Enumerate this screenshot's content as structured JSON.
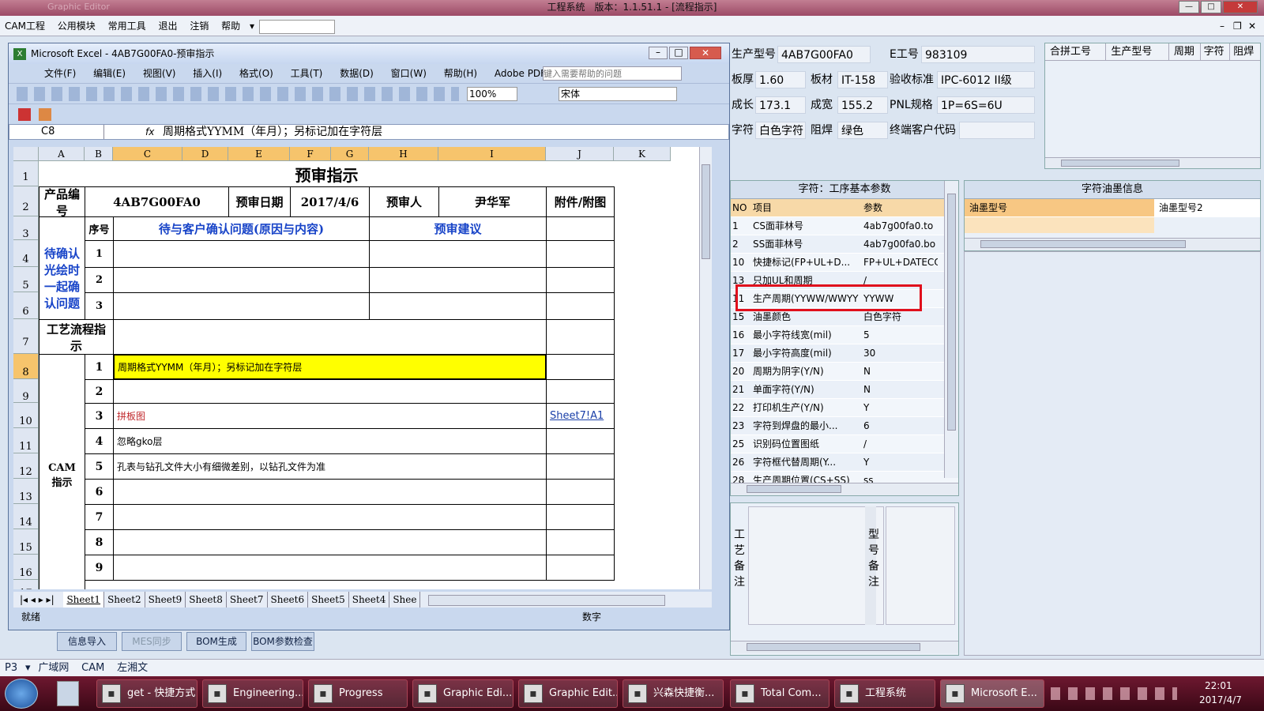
{
  "app": {
    "title": "工程系统　版本：1.1.51.1 - [流程指示]",
    "faint_title": "Graphic Editor",
    "min": "—",
    "max": "□",
    "close": "✕"
  },
  "menu": {
    "items": [
      "CAM工程",
      "公用模块",
      "常用工具",
      "退出",
      "注销",
      "帮助"
    ]
  },
  "info": {
    "model_label": "生产型号",
    "model": "4AB7G00FA0",
    "eno_label": "E工号",
    "eno": "983109",
    "thickness_label": "板厚",
    "thickness": "1.60",
    "material_label": "板材",
    "material": "IT-158",
    "standard_label": "验收标准",
    "standard": "IPC-6012 II级",
    "length_label": "成长",
    "length": "173.1",
    "width_label": "成宽",
    "width": "155.2",
    "pnl_label": "PNL规格",
    "pnl": "1P=6S=6U",
    "char_label": "字符",
    "char": "白色字符",
    "mask_label": "阻焊",
    "mask": "绿色",
    "enduser_label": "终端客户代码",
    "enduser": ""
  },
  "merge_table": {
    "headers": [
      "合拼工号",
      "生产型号",
      "周期",
      "字符",
      "阻焊"
    ]
  },
  "params": {
    "title": "字符：工序基本参数",
    "headers": [
      "NO",
      "项目",
      "参数"
    ],
    "rows": [
      [
        "1",
        "CS面菲林号",
        "4ab7g00fa0.to"
      ],
      [
        "2",
        "SS面菲林号",
        "4ab7g00fa0.bo"
      ],
      [
        "10",
        "快捷标记(FP+UL+D...",
        "FP+UL+DATECODE"
      ],
      [
        "13",
        "只加UL和周期",
        "/"
      ],
      [
        "11",
        "生产周期(YYWW/WWYY)",
        "YYWW"
      ],
      [
        "15",
        "油墨颜色",
        "白色字符"
      ],
      [
        "16",
        "最小字符线宽(mil)",
        "5"
      ],
      [
        "17",
        "最小字符高度(mil)",
        "30"
      ],
      [
        "20",
        "周期为阴字(Y/N)",
        "N"
      ],
      [
        "21",
        "单面字符(Y/N)",
        "N"
      ],
      [
        "22",
        "打印机生产(Y/N)",
        "Y"
      ],
      [
        "23",
        "字符到焊盘的最小...",
        "6"
      ],
      [
        "25",
        "识别码位置图纸",
        "/"
      ],
      [
        "26",
        "字符框代替周期(Y...",
        "Y"
      ],
      [
        "28",
        "生产周期位置(CS+SS)",
        "ss"
      ]
    ]
  },
  "ink": {
    "title": "字符油墨信息",
    "headers": [
      "油墨型号",
      "油墨型号2"
    ]
  },
  "remarks": {
    "process": "工艺备注",
    "model": "型号备注"
  },
  "bottom_buttons": [
    "信息导入",
    "MES同步",
    "BOM生成",
    "BOM参数检查"
  ],
  "statusrow": {
    "code": "P3",
    "items": [
      "广域网",
      "CAM",
      "左湘文"
    ]
  },
  "excel": {
    "title": "Microsoft Excel - 4AB7G00FA0-预审指示",
    "menu": [
      "文件(F)",
      "编辑(E)",
      "视图(V)",
      "插入(I)",
      "格式(O)",
      "工具(T)",
      "数据(D)",
      "窗口(W)",
      "帮助(H)",
      "Adobe PDF(B)"
    ],
    "help_placeholder": "键入需要帮助的问题",
    "zoom": "100%",
    "font": "宋体",
    "namebox": "C8",
    "fx": "fx",
    "formula": "周期格式YYMM（年月）；另标记加在字符层",
    "columns": [
      "A",
      "B",
      "C",
      "D",
      "E",
      "F",
      "G",
      "H",
      "I",
      "J",
      "K"
    ],
    "rows": [
      "1",
      "2",
      "3",
      "4",
      "5",
      "6",
      "7",
      "8",
      "9",
      "10",
      "11",
      "12",
      "13",
      "14",
      "15",
      "16",
      "17"
    ],
    "sheet_title": "预审指示",
    "product_label": "产品编号",
    "product": "4AB7G00FA0",
    "date_label": "预审日期",
    "date": "2017/4/6",
    "reviewer_label": "预审人",
    "reviewer": "尹华军",
    "attach_label": "附件/附图",
    "seq_label": "序号",
    "confirm_label": "待与客户确认问题(原因与内容)",
    "suggest_label": "预审建议",
    "pending_label": "待确认光绘时一起确认问题",
    "process_label": "工艺流程指示",
    "cam_label": "CAM指示",
    "seq": [
      "1",
      "2",
      "3",
      "4",
      "5",
      "6",
      "7",
      "8",
      "9"
    ],
    "pending_seq": [
      "1",
      "2",
      "3"
    ],
    "instr1": "周期格式YYMM（年月）；另标记加在字符层",
    "instr3": "拼板图",
    "link3": "Sheet7!A1",
    "instr4": "忽略gko层",
    "instr5": "孔表与钻孔文件大小有细微差别，以钻孔文件为准",
    "sheets": [
      "Sheet1",
      "Sheet2",
      "Sheet9",
      "Sheet8",
      "Sheet7",
      "Sheet6",
      "Sheet5",
      "Sheet4",
      "Shee"
    ],
    "status": "就绪",
    "num": "数字"
  },
  "taskbar": {
    "items": [
      "get - 快捷方式",
      "Engineering...",
      "Progress",
      "Graphic Edi...",
      "Graphic Edit...",
      "兴森快捷衡...",
      "Total Com...",
      "工程系统",
      "Microsoft E..."
    ],
    "time": "22:01",
    "date": "2017/4/7"
  },
  "colors": {
    "highlight": "#ffff00",
    "red_box": "#e0101c",
    "link": "#1a3fa8",
    "blue_text": "#1844c8"
  }
}
